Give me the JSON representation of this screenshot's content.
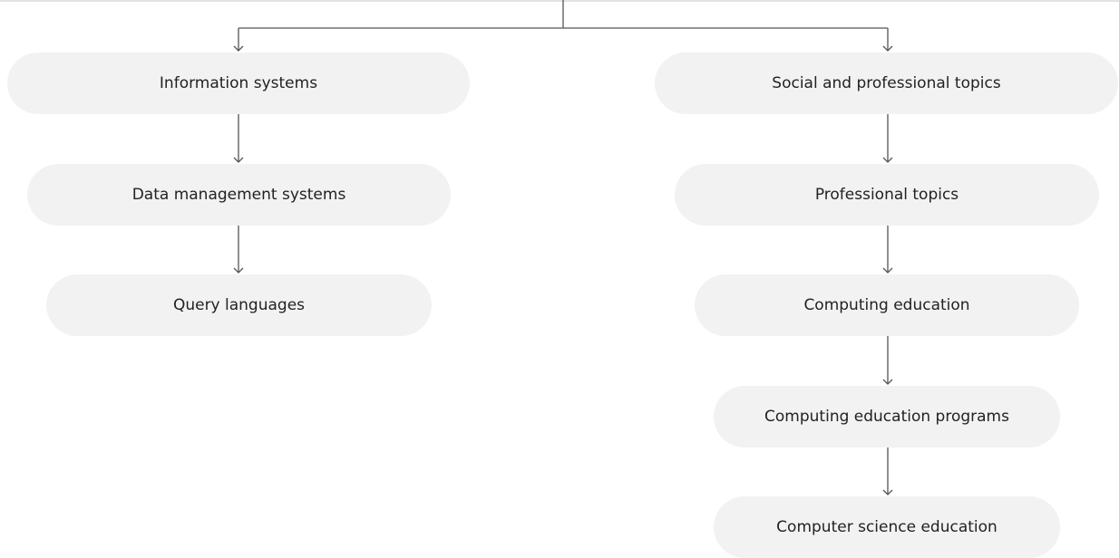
{
  "tree": {
    "left_branch": {
      "root": "Information systems",
      "child": "Data management systems",
      "grandchild": "Query languages"
    },
    "right_branch": {
      "root": "Social and professional topics",
      "level2": "Professional topics",
      "level3": "Computing education",
      "level4": "Computing education programs",
      "level5": "Computer science education"
    }
  },
  "colors": {
    "node_fill": "#f2f2f2",
    "node_text": "#222222",
    "connector": "#555555",
    "top_rule": "#e3e3e3"
  }
}
